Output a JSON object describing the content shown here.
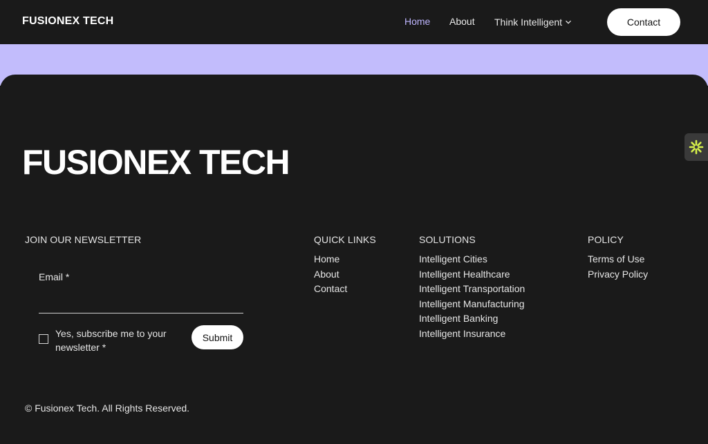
{
  "header": {
    "logo": "FUSIONEX TECH",
    "nav": {
      "home": "Home",
      "about": "About",
      "think": "Think Intelligent"
    },
    "contact_label": "Contact"
  },
  "footer": {
    "logo": "FUSIONEX TECH",
    "newsletter": {
      "heading": "JOIN OUR NEWSLETTER",
      "email_label": "Email *",
      "email_value": "",
      "subscribe_text": "Yes, subscribe me to your newsletter *",
      "submit_label": "Submit"
    },
    "quick_links": {
      "heading": "QUICK LINKS",
      "items": [
        "Home",
        "About",
        "Contact"
      ]
    },
    "solutions": {
      "heading": "SOLUTIONS",
      "items": [
        "Intelligent Cities",
        "Intelligent Healthcare",
        "Intelligent Transportation",
        "Intelligent Manufacturing",
        "Intelligent Banking",
        "Intelligent Insurance"
      ]
    },
    "policy": {
      "heading": "POLICY",
      "items": [
        "Terms of Use",
        "Privacy Policy"
      ]
    },
    "copyright": "© Fusionex Tech. All Rights Reserved."
  },
  "side_widget": {
    "icon": "asterisk-flower-icon"
  },
  "colors": {
    "background": "#1a1a1a",
    "accent_band": "#c2bcfc",
    "nav_active": "#bfb6ff",
    "widget_icon": "#d7f24a"
  }
}
